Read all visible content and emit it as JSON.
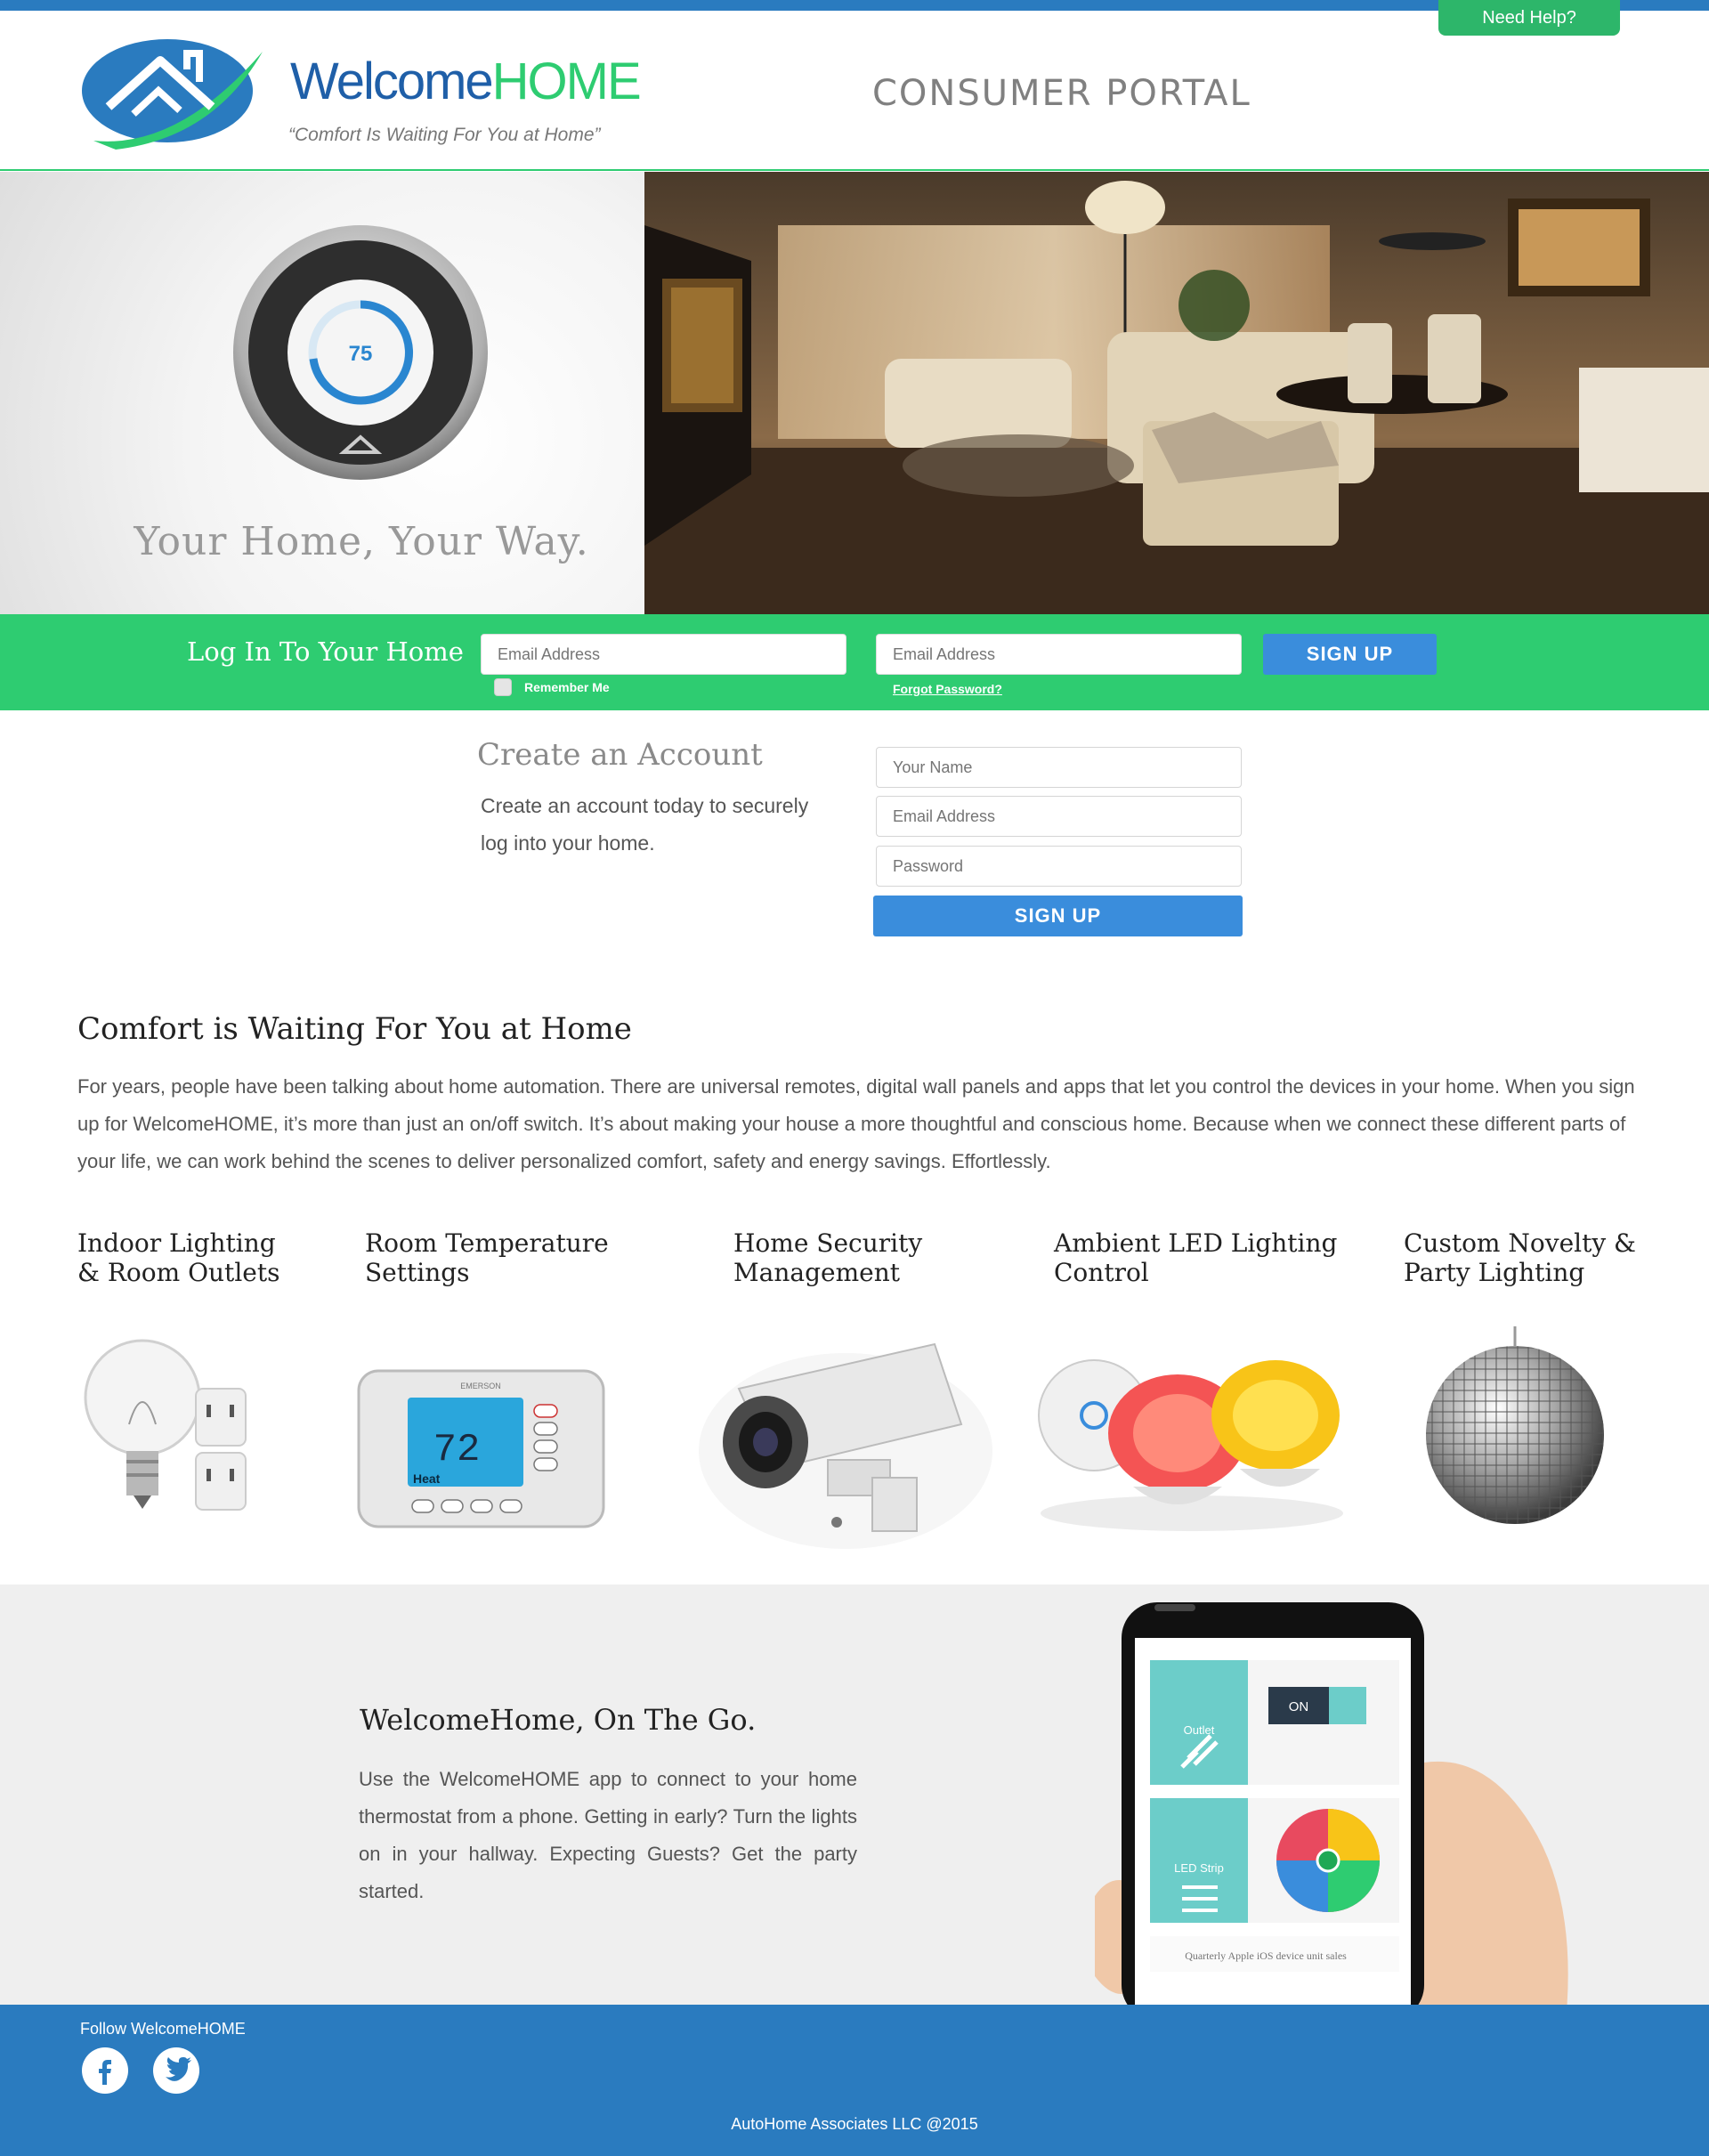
{
  "header": {
    "help_button": "Need Help?",
    "brand_part1": "Welcome",
    "brand_part2": "HOME",
    "tagline": "“Comfort Is Waiting For You at Home”",
    "portal_title": "CONSUMER PORTAL"
  },
  "hero": {
    "thermostat_temp": "75",
    "slogan": "Your Home, Your Way."
  },
  "login": {
    "title": "Log In To Your Home",
    "email_placeholder": "Email Address",
    "password_placeholder": "Email Address",
    "remember_label": "Remember Me",
    "forgot_label": "Forgot Password?",
    "signup_label": "SIGN UP"
  },
  "create_account": {
    "title": "Create an Account",
    "description": "Create an account today to securely log into your home.",
    "name_placeholder": "Your Name",
    "email_placeholder": "Email Address",
    "password_placeholder": "Password",
    "signup_label": "SIGN UP"
  },
  "comfort": {
    "title": "Comfort is Waiting For You at Home",
    "body": "For years, people have been talking about home automation. There are universal remotes, digital wall panels and apps that let you control the devices in your home. When you sign up for WelcomeHOME, it’s more than just an on/off switch. It’s about making your house a more thoughtful and conscious home. Because when we connect these different parts of your life, we can work behind the scenes to deliver personalized comfort, safety and energy savings. Effortlessly."
  },
  "features": [
    {
      "line1": "Indoor Lighting",
      "line2": "& Room Outlets",
      "icon": "lightbulb-outlet-icon"
    },
    {
      "line1": "Room Temperature",
      "line2": "Settings",
      "icon": "thermostat-icon"
    },
    {
      "line1": "Home Security",
      "line2": "Management",
      "icon": "security-camera-icon"
    },
    {
      "line1": "Ambient LED Lighting",
      "line2": "Control",
      "icon": "led-lamp-icon"
    },
    {
      "line1": "Custom Novelty &",
      "line2": "Party Lighting",
      "icon": "disco-ball-icon"
    }
  ],
  "feature_thermostat_reading": "72",
  "feature_thermostat_brand": "EMERSON",
  "feature_thermostat_modes": "Heat",
  "on_the_go": {
    "title": "WelcomeHome, On The Go.",
    "body": "Use the WelcomeHOME app to connect to your home thermostat from a phone. Getting in early? Turn the lights on in your hallway. Expecting Guests? Get the party started.",
    "phone_outlet_label": "Outlet",
    "phone_toggle_label": "ON",
    "phone_led_label": "LED Strip",
    "phone_footer_text": "Quarterly Apple iOS device unit sales"
  },
  "footer": {
    "follow_label": "Follow WelcomeHOME",
    "copyright": "AutoHome Associates LLC  @2015"
  },
  "colors": {
    "brand_blue": "#2a7bbf",
    "brand_green": "#2ecc71",
    "button_blue": "#3a8ddc",
    "teal": "#6ccdc9"
  }
}
